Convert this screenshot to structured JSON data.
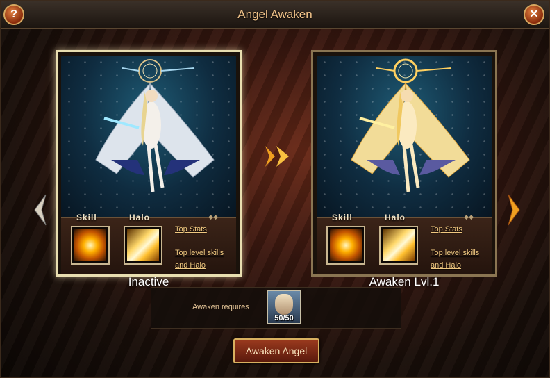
{
  "window": {
    "title": "Angel Awaken",
    "help_label": "?",
    "close_label": "✕"
  },
  "labels": {
    "skill": "Skill",
    "halo": "Halo"
  },
  "cards": [
    {
      "status": "Inactive",
      "link_stats": "Top Stats",
      "link_skills_1": "Top level skills",
      "link_skills_2": "and Halo",
      "selected": true
    },
    {
      "status": "Awaken Lvl.1",
      "link_stats": "Top Stats",
      "link_skills_1": "Top level skills",
      "link_skills_2": "and Halo",
      "selected": false
    }
  ],
  "requirement": {
    "label": "Awaken requires",
    "count": "50/50"
  },
  "action": {
    "label": "Awaken Angel"
  },
  "icons": {
    "help": "question-icon",
    "close": "close-icon",
    "next_arrow": "chevron-right-icon",
    "nav_left": "chevron-left-icon",
    "nav_right": "chevron-right-icon",
    "skill": "skill-burst-icon",
    "halo": "halo-light-icon"
  },
  "colors": {
    "title": "#f3c48a",
    "link": "#f0c880",
    "button": "#9a3a1e",
    "frame_border": "#8a7552"
  }
}
